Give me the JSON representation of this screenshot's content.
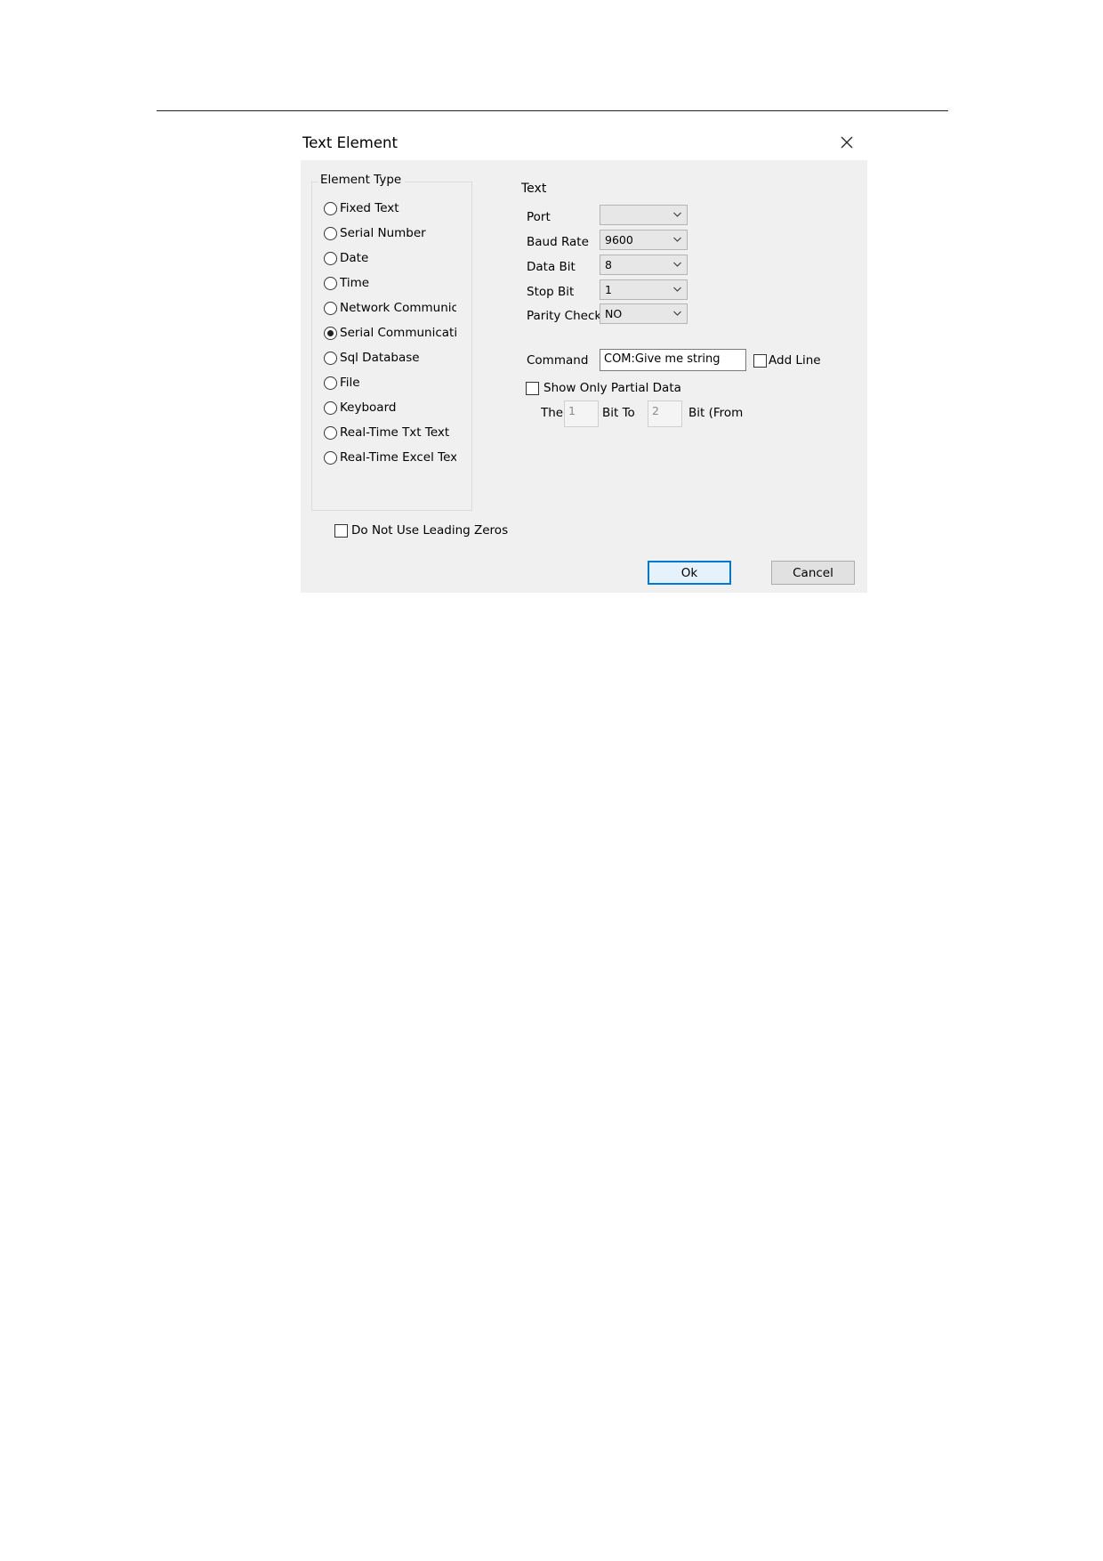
{
  "dialog": {
    "title": "Text Element"
  },
  "element_type": {
    "legend": "Element Type",
    "options": [
      {
        "label": "Fixed Text",
        "checked": false
      },
      {
        "label": "Serial Number",
        "checked": false
      },
      {
        "label": "Date",
        "checked": false
      },
      {
        "label": "Time",
        "checked": false
      },
      {
        "label": "Network Communica",
        "checked": false
      },
      {
        "label": "Serial Communicatio",
        "checked": true
      },
      {
        "label": "Sql Database",
        "checked": false
      },
      {
        "label": "File",
        "checked": false
      },
      {
        "label": "Keyboard",
        "checked": false
      },
      {
        "label": "Real-Time Txt Text",
        "checked": false
      },
      {
        "label": "Real-Time Excel Text",
        "checked": false
      }
    ]
  },
  "leading_zeros": {
    "label": "Do Not Use Leading Zeros",
    "checked": false
  },
  "text_panel": {
    "title": "Text",
    "port": {
      "label": "Port",
      "value": ""
    },
    "baud_rate": {
      "label": "Baud Rate",
      "value": "9600"
    },
    "data_bit": {
      "label": "Data Bit",
      "value": "8"
    },
    "stop_bit": {
      "label": "Stop Bit",
      "value": "1"
    },
    "parity_check": {
      "label": "Parity Check",
      "value": "NO"
    },
    "command": {
      "label": "Command",
      "value": "COM:Give me string"
    },
    "add_line": {
      "label": "Add Line",
      "checked": false
    },
    "partial": {
      "label": "Show Only Partial Data",
      "checked": false
    },
    "the_label": "The",
    "from_bit": "1",
    "bit_to_label": "Bit To",
    "to_bit": "2",
    "bit_from_label": "Bit (From"
  },
  "buttons": {
    "ok": "Ok",
    "cancel": "Cancel"
  },
  "colors": {
    "dialog_bg": "#f0f0f0",
    "default_button_border": "#0078d7"
  },
  "icons": {
    "close": "close-icon",
    "dropdown": "chevron-down-icon"
  }
}
